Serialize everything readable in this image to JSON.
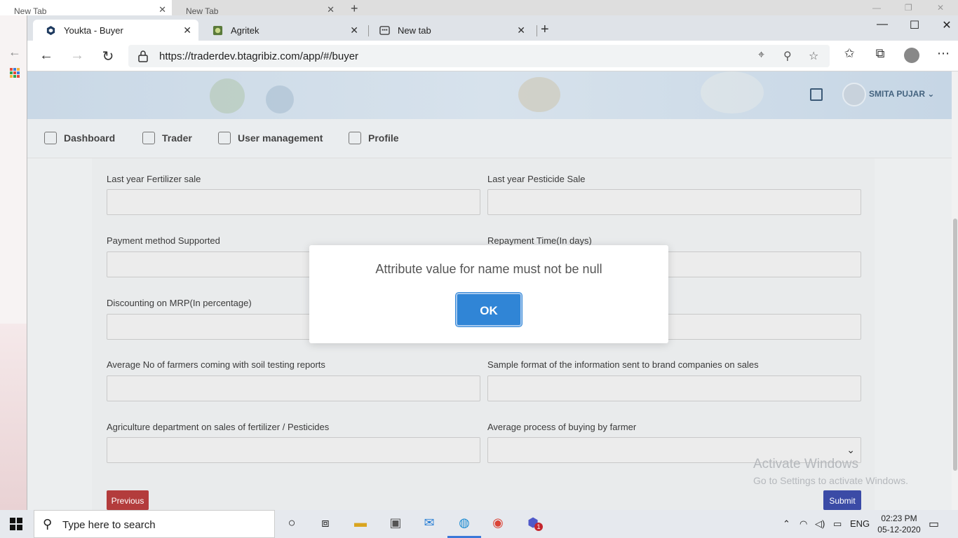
{
  "background_window": {
    "tabs": [
      {
        "title": "New Tab"
      },
      {
        "title": "New Tab"
      }
    ]
  },
  "browser": {
    "tabs": [
      {
        "title": "Youkta - Buyer",
        "icon": "hexagon-icon",
        "active": true
      },
      {
        "title": "Agritek",
        "icon": "agritek-logo-icon",
        "active": false
      },
      {
        "title": "New tab",
        "icon": "newtab-grid-icon",
        "active": false
      }
    ],
    "url": "https://traderdev.btagribiz.com/app/#/buyer"
  },
  "site": {
    "user_name": "SMITA PUJAR",
    "nav": [
      {
        "label": "Dashboard",
        "icon": "home-icon"
      },
      {
        "label": "Trader",
        "icon": "trader-icon"
      },
      {
        "label": "User management",
        "icon": "users-icon"
      },
      {
        "label": "Profile",
        "icon": "profile-icon"
      }
    ]
  },
  "form": {
    "fields": [
      {
        "label": "Last year Fertilizer sale",
        "value": ""
      },
      {
        "label": "Last year Pesticide Sale",
        "value": ""
      },
      {
        "label": "Payment method Supported",
        "value": ""
      },
      {
        "label": "Repayment Time(In days)",
        "value": ""
      },
      {
        "label": "Discounting on MRP(In percentage)",
        "value": ""
      },
      {
        "label": "",
        "value": ""
      },
      {
        "label": "Average No of farmers coming with soil testing reports",
        "value": ""
      },
      {
        "label": "Sample format of the information sent to brand companies on sales",
        "value": ""
      },
      {
        "label": "Agriculture department on sales of fertilizer / Pesticides",
        "value": ""
      },
      {
        "label": "Average process of buying by farmer",
        "value": ""
      }
    ],
    "previous_label": "Previous",
    "submit_label": "Submit"
  },
  "watermark": {
    "line1": "Activate Windows",
    "line2": "Go to Settings to activate Windows."
  },
  "modal": {
    "message": "Attribute value for name must not be null",
    "ok_label": "OK"
  },
  "taskbar": {
    "search_placeholder": "Type here to search",
    "language": "ENG",
    "time": "02:23 PM",
    "date": "05-12-2020",
    "teams_badge": "1"
  }
}
